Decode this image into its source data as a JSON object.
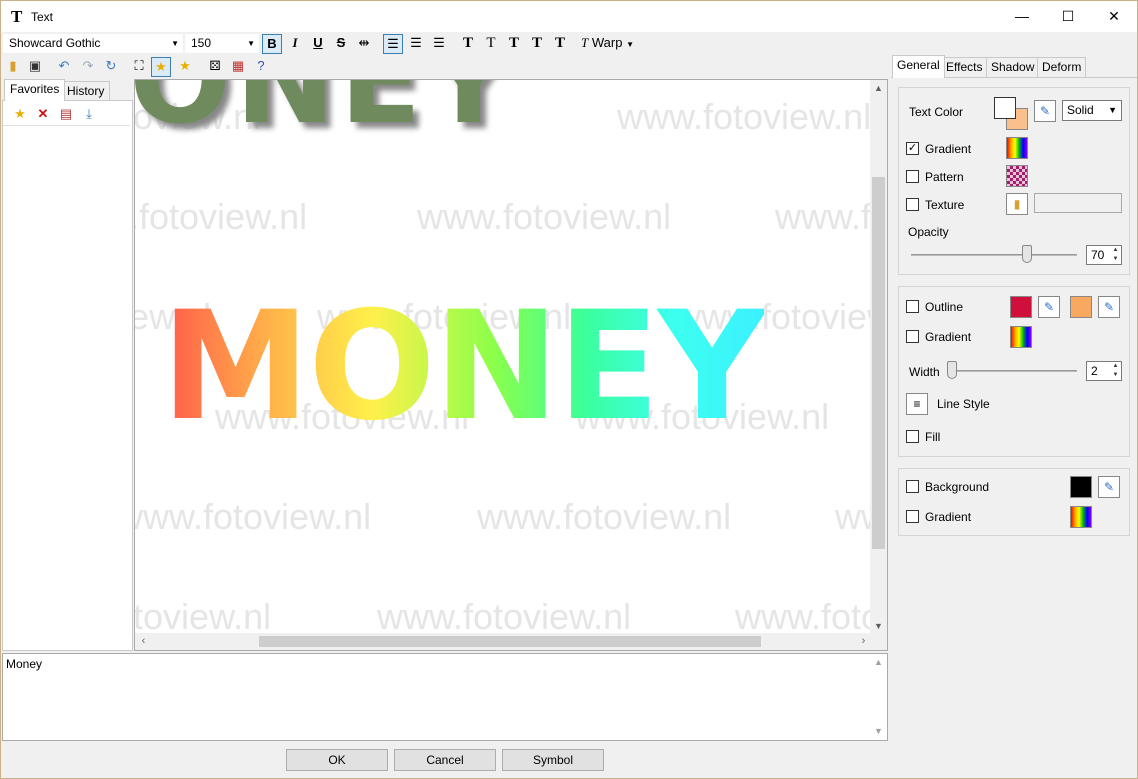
{
  "window": {
    "title": "Text",
    "minimize": "—",
    "maximize": "☐",
    "close": "✕"
  },
  "font": {
    "family": "Showcard Gothic",
    "size": "150"
  },
  "toolbar": {
    "warp_label": "Warp"
  },
  "left_tabs": [
    "Favorites",
    "History"
  ],
  "canvas": {
    "watermark": "www.fotoview.nl",
    "top_text": "ONEY",
    "main_text": "MONEY"
  },
  "text_input": {
    "value": "Money"
  },
  "buttons": {
    "ok": "OK",
    "cancel": "Cancel",
    "symbol": "Symbol"
  },
  "right_tabs": [
    "General",
    "Effects",
    "Shadow",
    "Deform"
  ],
  "general": {
    "text_color_label": "Text Color",
    "fill_mode": "Solid",
    "gradient_label": "Gradient",
    "gradient_checked": true,
    "pattern_label": "Pattern",
    "texture_label": "Texture",
    "opacity_label": "Opacity",
    "opacity_value": "70",
    "outline_label": "Outline",
    "outline_gradient_label": "Gradient",
    "width_label": "Width",
    "width_value": "2",
    "line_style_label": "Line Style",
    "fill_label": "Fill",
    "background_label": "Background",
    "background_gradient_label": "Gradient"
  },
  "colors": {
    "text_color_front": "#ffffff",
    "text_color_back": "#f9c08e",
    "outline_color_1": "#d0103a",
    "outline_color_2": "#f9a860",
    "background_color": "#000000"
  }
}
